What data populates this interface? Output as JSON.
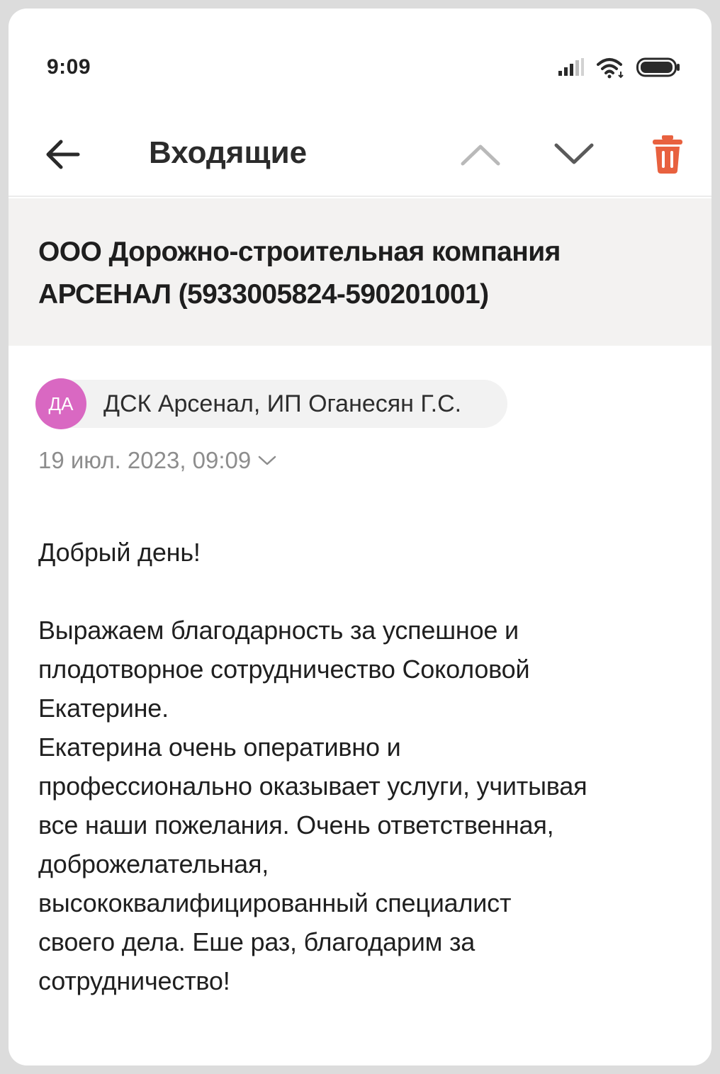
{
  "status_bar": {
    "time": "9:09",
    "battery_level": "90",
    "icons": [
      "signal-icon",
      "wifi-icon",
      "battery-icon"
    ]
  },
  "header": {
    "back_icon": "arrow-left-icon",
    "title": "Входящие",
    "prev_icon": "chevron-up-icon",
    "next_icon": "chevron-down-icon",
    "delete_icon": "trash-icon"
  },
  "colors": {
    "delete_accent": "#e8613f",
    "avatar_bg": "#d968c2",
    "subject_bg": "#f3f2f1",
    "muted_text": "#8d8d8d"
  },
  "message": {
    "subject_line1": "ООО Дорожно-строительная компания",
    "subject_line2": "АРСЕНАЛ (5933005824-590201001)",
    "sender": {
      "initials": "ДА",
      "name": "ДСК Арсенал, ИП Оганесян Г.С."
    },
    "date": "19 июл. 2023, 09:09",
    "body": {
      "greeting": "Добрый день!",
      "lines": [
        "Выражаем благодарность за успешное и",
        "плодотворное сотрудничество Соколовой",
        "Екатерине.",
        "Екатерина очень оперативно и",
        "профессионально оказывает услуги, учитывая",
        "все наши пожелания. Очень ответственная,",
        "доброжелательная,",
        "высококвалифицированный специалист",
        "своего дела. Еше раз, благодарим за",
        "сотрудничество!"
      ]
    }
  }
}
